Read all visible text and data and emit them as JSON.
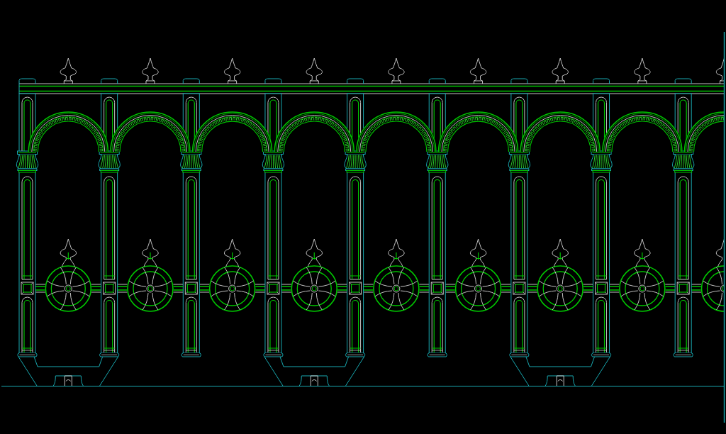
{
  "railing": {
    "bays": [
      {
        "kind": "footed"
      },
      {
        "kind": "open"
      },
      {
        "kind": "open"
      },
      {
        "kind": "footed"
      },
      {
        "kind": "open"
      },
      {
        "kind": "open"
      },
      {
        "kind": "footed"
      },
      {
        "kind": "open"
      },
      {
        "kind": "cut"
      }
    ]
  }
}
